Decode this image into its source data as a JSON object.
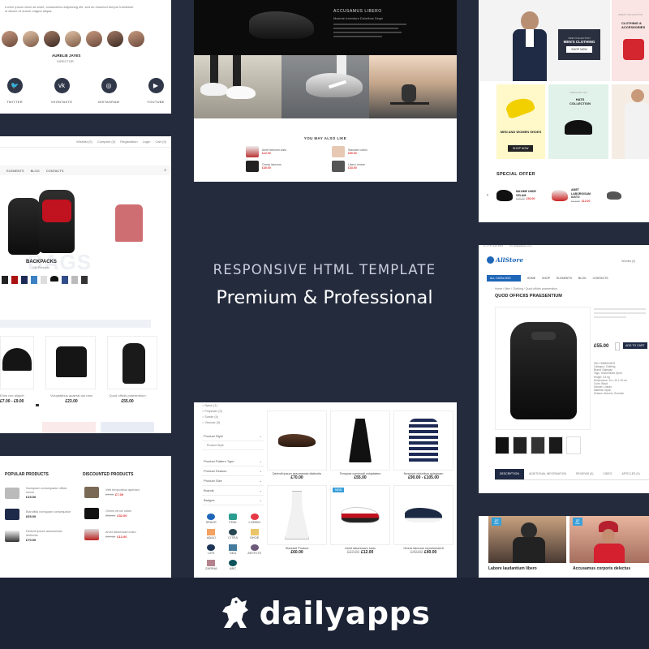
{
  "headline": {
    "line1": "RESPONSIVE HTML TEMPLATE",
    "line2": "Premium & Professional"
  },
  "brand": {
    "name": "dailyapps",
    "logo_icon": "horse-icon"
  },
  "colors": {
    "background": "#242b3d",
    "footer": "#1c2335",
    "accent": "#1e66b8",
    "price_red": "#d33333"
  },
  "team_card": {
    "intro": "Lorem ipsum dolor sit amet, consectetur adipiscing elit, sed do eiusmod tempor incididunt ut labore et dolore magna aliqua.",
    "person_name": "AURELIE JAYES",
    "person_role": "DIRECTOR",
    "social": [
      {
        "label": "TWITTER",
        "icon": "twitter-icon",
        "glyph": "🐦"
      },
      {
        "label": "VKONTAKTE",
        "icon": "vk-icon",
        "glyph": "vk"
      },
      {
        "label": "INSTAGRAM",
        "icon": "instagram-icon",
        "glyph": "◎"
      },
      {
        "label": "YOUTUBE",
        "icon": "youtube-icon",
        "glyph": "▶"
      }
    ]
  },
  "shoes_card": {
    "hero_title": "ACCUSAMUS LIBERO",
    "hero_subtitle": "Maxime Inventore Doloribus Sequi",
    "you_may_also_like": "YOU MAY ALSO LIKE",
    "minis": [
      {
        "name": "Amet laborum iusto",
        "price": "£12.00"
      },
      {
        "name": "Standart cotton",
        "price": "£60.00"
      },
      {
        "name": "Omnis laborum",
        "price": "£40.00"
      },
      {
        "name": "Libero ornare",
        "price": "£33.00"
      }
    ]
  },
  "fashion_card": {
    "tile1_tag": "NEW COLLECTION",
    "tile1_title": "MEN'S CLOTHING",
    "tile1_btn": "SHOP NOW",
    "tile2_tag": "GREAT COLLECTION",
    "tile2_title": "CLOTHING & ACCESSORIES",
    "tile3_title": "MEN AND WOMEN SHOES",
    "tile3_btn": "SHOP NOW",
    "tile4_tag": "DISCOUNT ON",
    "tile4_title": "HATS COLLECTION",
    "special_offer": "SPECIAL OFFER",
    "offers": [
      {
        "name": "MAXIME UNDE VELAM",
        "old": "£49.00",
        "price": "£30.00"
      },
      {
        "name": "AMET LABORIOSAM IUSTO",
        "old": "£17.00",
        "price": "£12.00"
      }
    ]
  },
  "backpack_card": {
    "topbar": [
      "Wishlist (0)",
      "Compare (0)",
      "Registration",
      "Login",
      "Cart (0)"
    ],
    "nav": [
      "ELEMENTS",
      "BLOG",
      "CONTACTS"
    ],
    "category_title": "BACKPACKS",
    "category_count": "132 Products",
    "products": [
      {
        "name": "Enim nec aliquet",
        "price": "£7.00 - £9.00"
      },
      {
        "name": "Voluptatibus quaerat aut nam",
        "price": "£23.00"
      },
      {
        "name": "Quod officiis praesentium",
        "price": "£55.00"
      }
    ]
  },
  "product_card": {
    "logo": "AllStore",
    "wishlist": "Wishlist (0)",
    "nav": [
      "ALL CATALOGS",
      "HOME",
      "SHOP",
      "ELEMENTS",
      "BLOG",
      "CONTACTS"
    ],
    "breadcrumb": "Home / Men / Clothing / Quod officiis praesentium",
    "title": "QUOD OFFICIIS PRAESENTIUM",
    "price": "£55.00",
    "add_to_cart": "ADD TO CART",
    "details": [
      "SKU: 5684543679",
      "Category: Clothing",
      "Brand: Gateway",
      "Tags: Yellow Black Sport",
      "Height: 0.4 kg",
      "Dimensions: 10 x 10 x 10 cm",
      "Color: Black",
      "Gender: Unisex",
      "Material: Nylon",
      "Season: Autumn, Summer"
    ],
    "tabs": [
      "DESCRIPTION",
      "ADDITIONAL INFORMATION",
      "REVIEWS (0)",
      "VIDEO",
      "ARTICLES (0)"
    ]
  },
  "lists_card": {
    "popular_title": "POPULAR PRODUCTS",
    "discounted_title": "DISCOUNTED PRODUCTS",
    "popular": [
      {
        "name": "Numquam consequatur officia omnis",
        "price": "£15.00"
      },
      {
        "name": "Blanditiis numquam consequatur",
        "price": "£65.00"
      },
      {
        "name": "Deleniti ipsum assumenda distinctio",
        "price": "£70.00"
      }
    ],
    "discounted": [
      {
        "name": "Velit temporibus aperiam",
        "old": "£9.00",
        "price": "£7.00"
      },
      {
        "name": "Omnis rerum ullam",
        "old": "£38.00",
        "price": "£32.00"
      },
      {
        "name": "Amet laboriosam iusto",
        "old": "£17.00",
        "price": "£12.00"
      }
    ]
  },
  "filter_card": {
    "checks": [
      "Nylon (1)",
      "Polyester (3)",
      "Suede (4)",
      "Viscose (3)"
    ],
    "filters": [
      "Product Style",
      "Product Pattern Type",
      "Product Season",
      "Product Size",
      "Brands",
      "Badges"
    ],
    "style_sub": "Product Style",
    "brands": [
      "SPACE",
      "FRAI",
      "LOREM",
      "ABAO",
      "CITRA",
      "SHOE",
      "LIFE",
      "SEA",
      "ARTISTS",
      "ZARINA",
      "ABC"
    ],
    "products": [
      {
        "name": "Deleniti ipsum assumenda distinctio",
        "price": "£70.00",
        "badge": ""
      },
      {
        "name": "Tempora commodi voluptatem",
        "price": "£55.00",
        "badge": ""
      },
      {
        "name": "Nesciunt doloribus quisquam",
        "price": "£90.00 - £105.00",
        "badge": ""
      },
      {
        "name": "Standart Product",
        "price": "£60.00",
        "badge": ""
      },
      {
        "name": "Amet laboriosam iusto",
        "old": "£17.00",
        "price": "£12.00",
        "badge": "NEW"
      },
      {
        "name": "Omnis laborum reprehenderit",
        "old": "£49.00",
        "price": "£40.00",
        "badge": ""
      }
    ]
  },
  "blog_card": {
    "posts": [
      {
        "day": "27",
        "month": "DEC",
        "title": "Labore laudantium libero"
      },
      {
        "day": "27",
        "month": "DEC",
        "title": "Accusamus corporis delectus"
      }
    ]
  }
}
